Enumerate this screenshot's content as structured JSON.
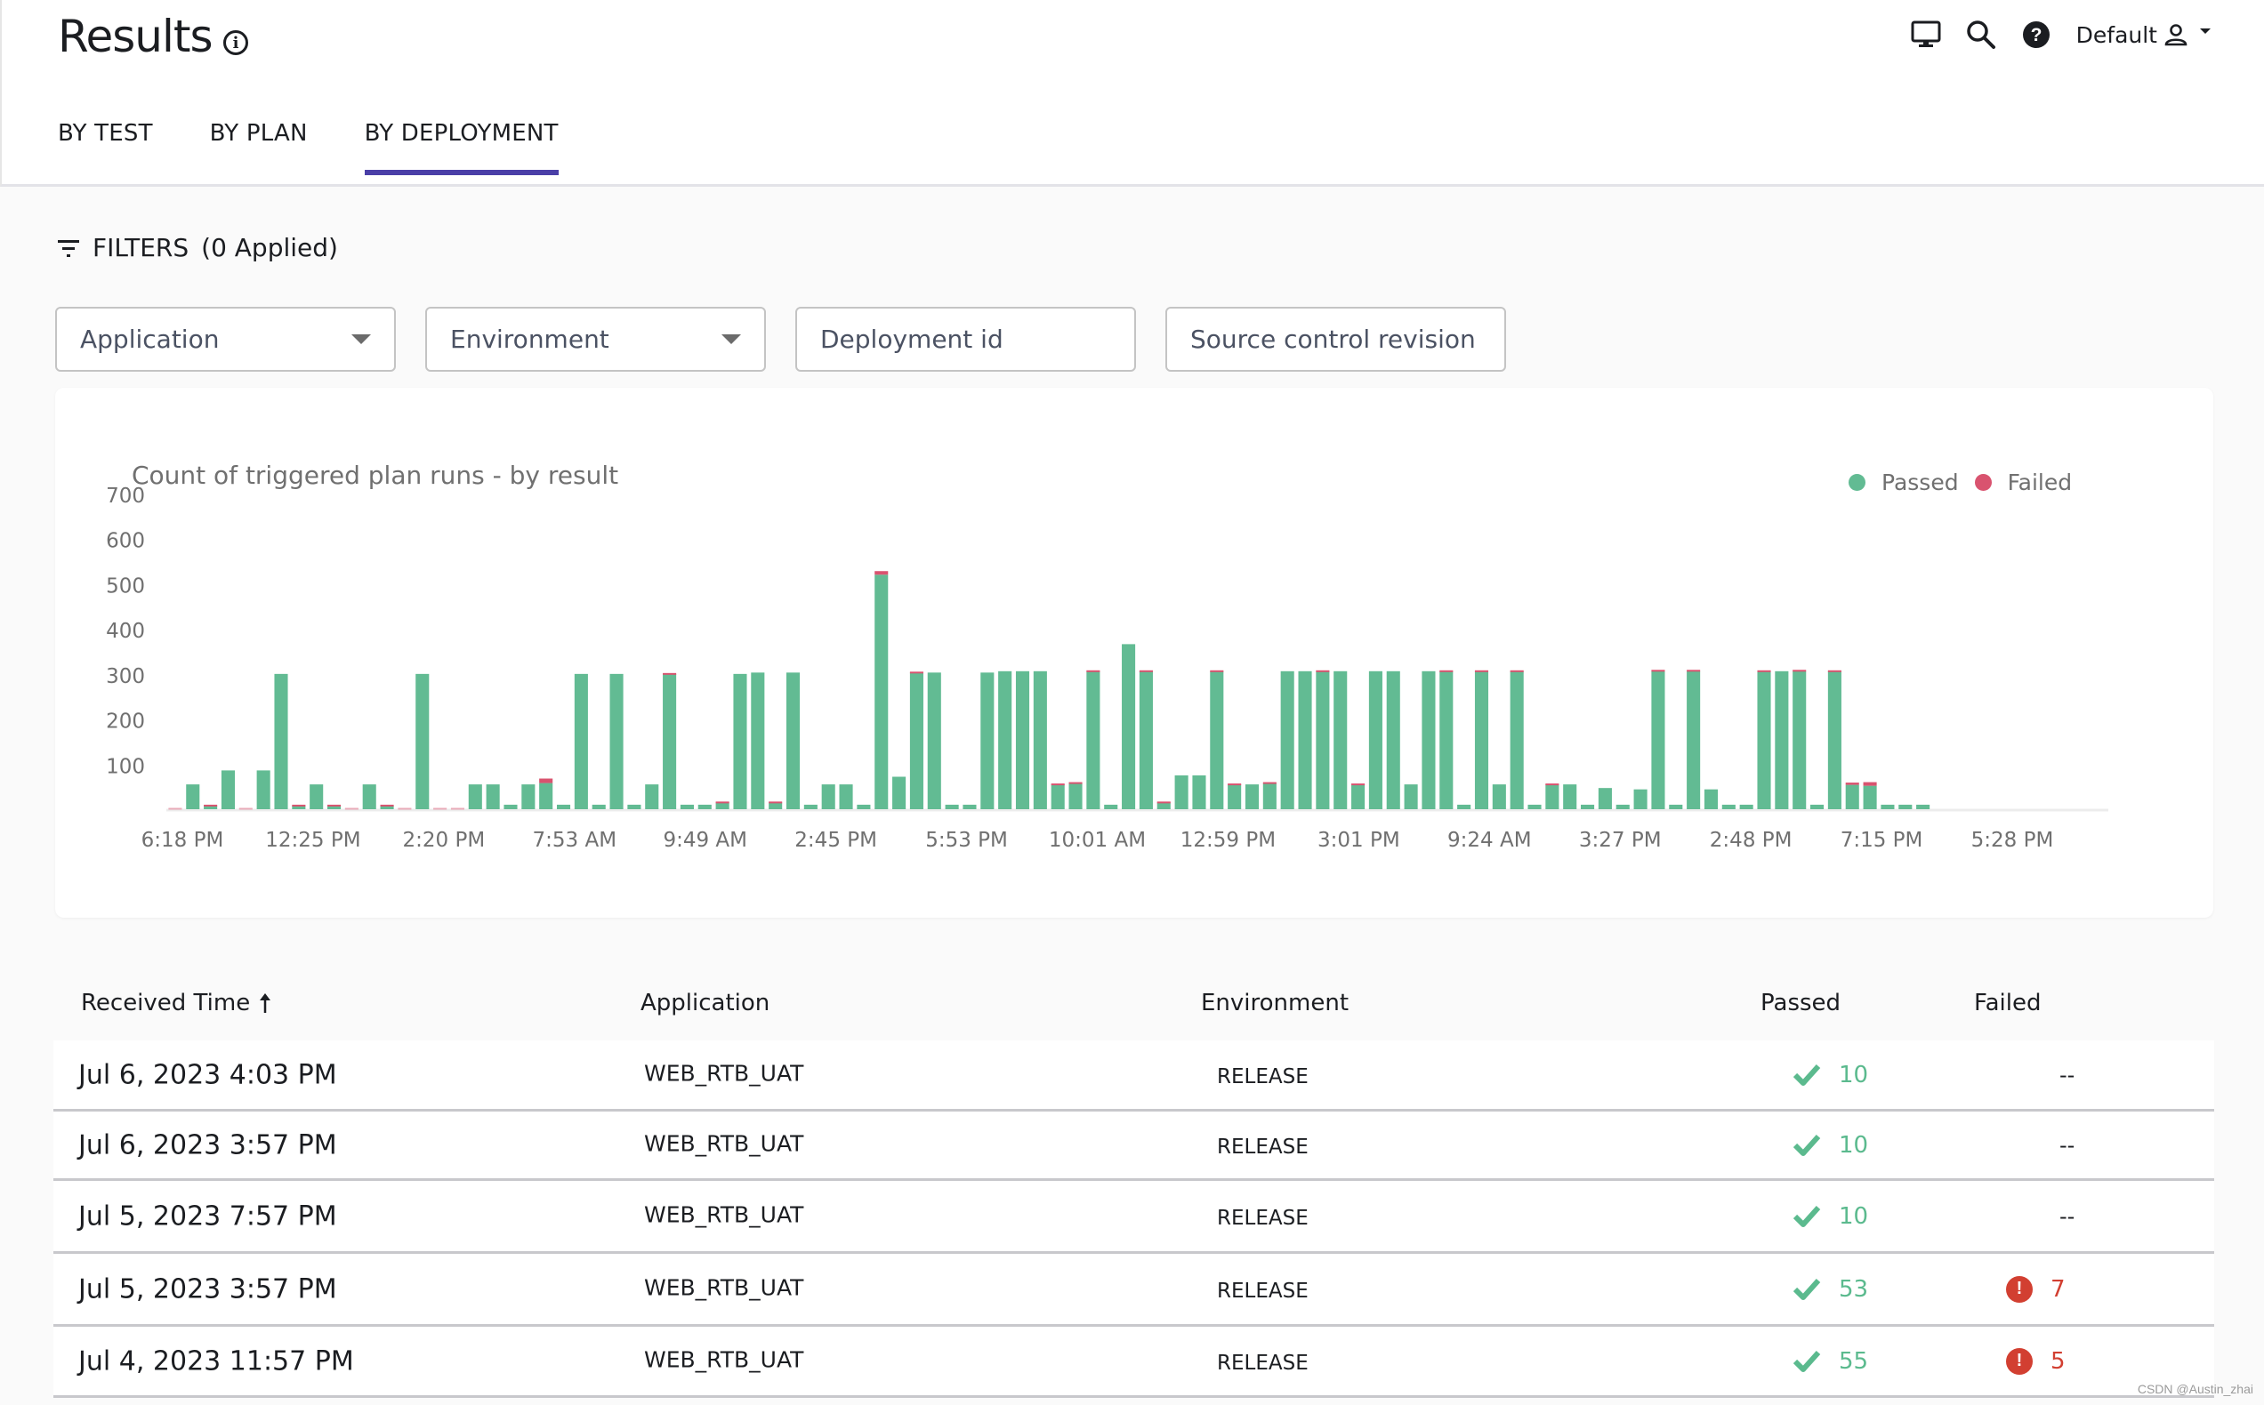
{
  "header": {
    "title": "Results",
    "info_icon": "info-circle-icon",
    "toolbar_icons": [
      "monitor-icon",
      "search-icon",
      "help-icon"
    ],
    "user_label": "Default",
    "user_icon": "user-icon"
  },
  "tabs": [
    {
      "label": "BY TEST",
      "active": false
    },
    {
      "label": "BY PLAN",
      "active": false
    },
    {
      "label": "BY DEPLOYMENT",
      "active": true
    }
  ],
  "filters": {
    "label": "FILTERS",
    "applied": "(0 Applied)",
    "fields": [
      {
        "placeholder": "Application",
        "type": "select"
      },
      {
        "placeholder": "Environment",
        "type": "select"
      },
      {
        "placeholder": "Deployment id",
        "type": "text"
      },
      {
        "placeholder": "Source control revision",
        "type": "text"
      }
    ]
  },
  "colors": {
    "passed": "#62bb93",
    "failed": "#d9536f",
    "accent": "#4a3fa7",
    "error": "#d23f31"
  },
  "chart_data": {
    "type": "bar",
    "stacked": true,
    "title": "Count of triggered plan runs - by result",
    "xlabel": "",
    "ylabel": "",
    "ylim": [
      0,
      700
    ],
    "yticks": [
      100,
      200,
      300,
      400,
      500,
      600,
      700
    ],
    "grid": false,
    "legend_position": "top-right",
    "legend": [
      "Passed",
      "Failed"
    ],
    "x_tick_labels": [
      "6:18 PM",
      "12:25 PM",
      "2:20 PM",
      "7:53 AM",
      "9:49 AM",
      "2:45 PM",
      "5:53 PM",
      "10:01 AM",
      "12:59 PM",
      "3:01 PM",
      "9:24 AM",
      "3:27 PM",
      "2:48 PM",
      "7:15 PM",
      "5:28 PM"
    ],
    "series": [
      {
        "name": "Passed",
        "values": [
          0,
          55,
          8,
          86,
          0,
          86,
          300,
          8,
          55,
          8,
          0,
          55,
          8,
          0,
          300,
          0,
          0,
          55,
          55,
          10,
          55,
          58,
          10,
          300,
          10,
          300,
          10,
          55,
          300,
          10,
          10,
          15,
          300,
          303,
          15,
          303,
          10,
          55,
          55,
          10,
          520,
          72,
          303,
          303,
          10,
          10,
          303,
          306,
          306,
          306,
          55,
          57,
          306,
          10,
          366,
          306,
          15,
          75,
          75,
          306,
          55,
          55,
          57,
          306,
          306,
          306,
          306,
          55,
          306,
          306,
          55,
          306,
          306,
          10,
          306,
          55,
          306,
          10,
          55,
          55,
          10,
          47,
          10,
          44,
          306,
          10,
          306,
          44,
          10,
          10,
          306,
          306,
          306,
          10,
          306,
          54,
          52,
          10,
          10,
          10
        ]
      },
      {
        "name": "Failed",
        "values": [
          3,
          0,
          2,
          0,
          3,
          0,
          0,
          2,
          0,
          2,
          3,
          0,
          2,
          3,
          0,
          3,
          3,
          0,
          0,
          0,
          0,
          10,
          0,
          0,
          0,
          0,
          0,
          0,
          2,
          0,
          0,
          2,
          0,
          0,
          2,
          0,
          0,
          0,
          0,
          0,
          8,
          0,
          2,
          0,
          0,
          0,
          0,
          0,
          0,
          0,
          2,
          3,
          2,
          0,
          0,
          2,
          2,
          0,
          0,
          2,
          2,
          0,
          3,
          0,
          0,
          2,
          0,
          2,
          0,
          0,
          0,
          0,
          2,
          0,
          2,
          0,
          2,
          0,
          2,
          0,
          0,
          0,
          0,
          0,
          3,
          0,
          3,
          0,
          0,
          0,
          2,
          0,
          3,
          0,
          2,
          5,
          8,
          0,
          0,
          0
        ]
      }
    ]
  },
  "table": {
    "columns": [
      {
        "label": "Received Time",
        "sort_icon": "arrow-up-icon"
      },
      {
        "label": "Application"
      },
      {
        "label": "Environment"
      },
      {
        "label": "Passed"
      },
      {
        "label": "Failed"
      }
    ],
    "rows": [
      {
        "time": "Jul 6, 2023 4:03 PM",
        "application": "WEB_RTB_UAT",
        "environment": "RELEASE",
        "passed": "10",
        "failed": "--"
      },
      {
        "time": "Jul 6, 2023 3:57 PM",
        "application": "WEB_RTB_UAT",
        "environment": "RELEASE",
        "passed": "10",
        "failed": "--"
      },
      {
        "time": "Jul 5, 2023 7:57 PM",
        "application": "WEB_RTB_UAT",
        "environment": "RELEASE",
        "passed": "10",
        "failed": "--"
      },
      {
        "time": "Jul 5, 2023 3:57 PM",
        "application": "WEB_RTB_UAT",
        "environment": "RELEASE",
        "passed": "53",
        "failed": "7"
      },
      {
        "time": "Jul 4, 2023 11:57 PM",
        "application": "WEB_RTB_UAT",
        "environment": "RELEASE",
        "passed": "55",
        "failed": "5"
      }
    ]
  },
  "watermark": "CSDN @Austin_zhai"
}
